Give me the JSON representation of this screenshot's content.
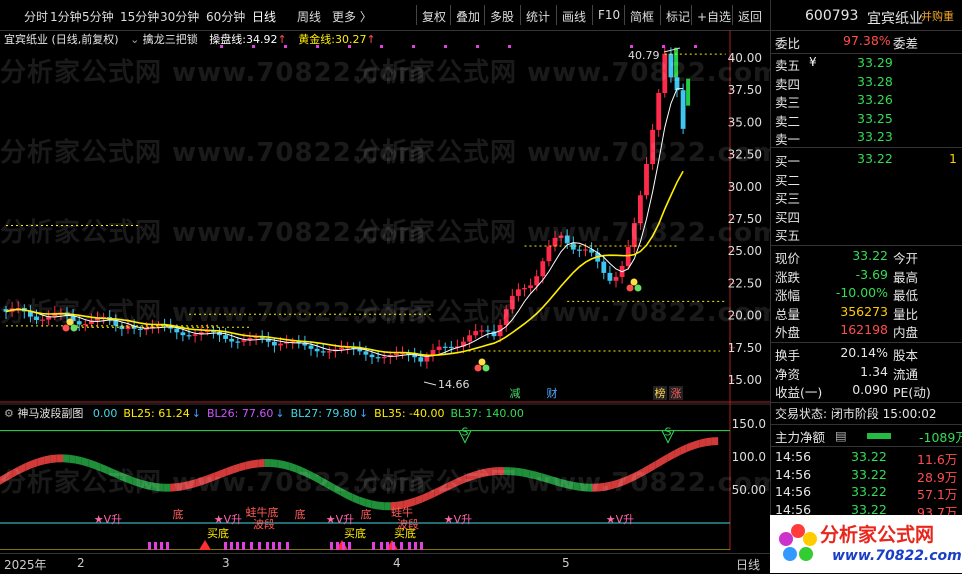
{
  "toolbar": {
    "periods": [
      "分时",
      "1分钟",
      "5分钟",
      "15分钟",
      "30分钟",
      "60分钟",
      "日线",
      "周线",
      "更多 〉"
    ],
    "active_period": "日线",
    "actions": [
      "复权",
      "叠加",
      "多股",
      "统计",
      "画线",
      "F10",
      "简框",
      "标记",
      "+自选",
      "返回"
    ]
  },
  "main_chart": {
    "title": "宜宾纸业 (日线,前复权)",
    "indicator_name": "擒龙三把锁",
    "lines": [
      {
        "label": "操盘线:",
        "value": "34.92",
        "arrow": "↑",
        "color": "#ffffff"
      },
      {
        "label": "黄金线:",
        "value": "30.27",
        "arrow": "↑",
        "color": "#ffee00"
      }
    ],
    "price_axis": [
      "40.00",
      "37.50",
      "35.00",
      "32.50",
      "30.00",
      "27.50",
      "25.00",
      "22.50",
      "20.00",
      "17.50",
      "15.00"
    ],
    "high_marker": "40.79",
    "low_marker": "14.66",
    "tags": [
      "减",
      "财",
      "榜",
      "涨"
    ]
  },
  "sub_chart": {
    "title": "神马波段副图",
    "values": [
      {
        "label": "0.00",
        "color": "#40d8e8"
      },
      {
        "label": "BL25: 61.24",
        "color": "#ffee00",
        "arrow": "↓"
      },
      {
        "label": "BL26: 77.60",
        "color": "#cc55ff",
        "arrow": "↓"
      },
      {
        "label": "BL27: 79.80",
        "color": "#40d8e8",
        "arrow": "↓"
      },
      {
        "label": "BL35: -40.00",
        "color": "#ffee00"
      },
      {
        "label": "BL37: 140.00",
        "color": "#33dd55"
      }
    ],
    "axis": [
      "150.0",
      "100.0",
      "50.00"
    ],
    "annotations": [
      "★V升",
      "底",
      "★V升",
      "蛙牛底",
      "波段",
      "底",
      "★V升",
      "底",
      "蛙牛",
      "波段",
      "★V升",
      "★V升",
      "买底",
      "买底",
      "买底"
    ],
    "s_marks": [
      "S",
      "S"
    ]
  },
  "time_axis": [
    "2025年",
    "2",
    "3",
    "4",
    "5"
  ],
  "right_label": "日线",
  "quote": {
    "code": "600793",
    "name": "宜宾纸业",
    "tag": "并购重",
    "webi_label": "委比",
    "webi": "97.38%",
    "weicha_label": "委差",
    "sells": [
      {
        "label": "卖五",
        "price": "33.29"
      },
      {
        "label": "卖四",
        "price": "33.28"
      },
      {
        "label": "卖三",
        "price": "33.26"
      },
      {
        "label": "卖二",
        "price": "33.25"
      },
      {
        "label": "卖一",
        "price": "33.23"
      }
    ],
    "buys": [
      {
        "label": "买一",
        "price": "33.22",
        "vol": "1"
      },
      {
        "label": "买二",
        "price": ""
      },
      {
        "label": "买三",
        "price": ""
      },
      {
        "label": "买四",
        "price": ""
      },
      {
        "label": "买五",
        "price": ""
      }
    ],
    "stats": [
      {
        "l1": "现价",
        "v1": "33.22",
        "c1": "green",
        "l2": "今开",
        "v2": ""
      },
      {
        "l1": "涨跌",
        "v1": "-3.69",
        "c1": "green",
        "l2": "最高",
        "v2": ""
      },
      {
        "l1": "涨幅",
        "v1": "-10.00%",
        "c1": "green",
        "l2": "最低",
        "v2": ""
      },
      {
        "l1": "总量",
        "v1": "356273",
        "c1": "yellow",
        "l2": "量比",
        "v2": ""
      },
      {
        "l1": "外盘",
        "v1": "162198",
        "c1": "red",
        "l2": "内盘",
        "v2": ""
      }
    ],
    "stats2": [
      {
        "l1": "换手",
        "v1": "20.14%",
        "l2": "股本"
      },
      {
        "l1": "净资",
        "v1": "1.34",
        "l2": "流通"
      },
      {
        "l1": "收益(一)",
        "v1": "0.090",
        "l2": "PE(动)"
      }
    ],
    "trade_status": "交易状态: 闭市阶段 15:00:02",
    "main_flow_label": "主力净额",
    "main_flow_value": "-1089万",
    "ticks": [
      {
        "time": "14:56",
        "price": "33.22",
        "vol": "11.6万"
      },
      {
        "time": "14:56",
        "price": "33.22",
        "vol": "28.9万"
      },
      {
        "time": "14:56",
        "price": "33.22",
        "vol": "57.1万"
      },
      {
        "time": "14:56",
        "price": "33.22",
        "vol": "93.7万"
      }
    ]
  },
  "watermark": "分析家公式网 www.70822.com",
  "logo": {
    "title": "分析家公式网",
    "url": "www.70822.com"
  }
}
